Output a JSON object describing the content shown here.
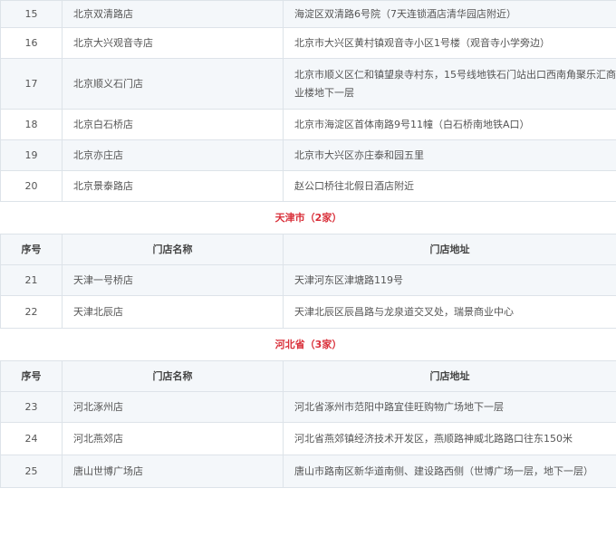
{
  "regions": [
    {
      "title": "",
      "show_header": false,
      "rows": [
        {
          "no": "15",
          "name": "北京双清路店",
          "addr": "海淀区双清路6号院（7天连锁酒店清华园店附近）"
        },
        {
          "no": "16",
          "name": "北京大兴观音寺店",
          "addr": "北京市大兴区黄村镇观音寺小区1号楼（观音寺小学旁边）"
        },
        {
          "no": "17",
          "name": "北京顺义石门店",
          "addr": "北京市顺义区仁和镇望泉寺村东，15号线地铁石门站出口西南角聚乐汇商业楼地下一层"
        },
        {
          "no": "18",
          "name": "北京白石桥店",
          "addr": "北京市海淀区首体南路9号11幢（白石桥南地铁A口）"
        },
        {
          "no": "19",
          "name": "北京亦庄店",
          "addr": "北京市大兴区亦庄泰和园五里"
        },
        {
          "no": "20",
          "name": "北京景泰路店",
          "addr": "赵公口桥往北假日酒店附近"
        }
      ]
    },
    {
      "title": "天津市（2家）",
      "show_header": true,
      "rows": [
        {
          "no": "21",
          "name": "天津一号桥店",
          "addr": "天津河东区津塘路119号"
        },
        {
          "no": "22",
          "name": "天津北辰店",
          "addr": "天津北辰区辰昌路与龙泉道交叉处，瑞景商业中心"
        }
      ]
    },
    {
      "title": "河北省（3家）",
      "show_header": true,
      "rows": [
        {
          "no": "23",
          "name": "河北涿州店",
          "addr": "河北省涿州市范阳中路宜佳旺购物广场地下一层"
        },
        {
          "no": "24",
          "name": "河北燕郊店",
          "addr": "河北省燕郊镇经济技术开发区，燕顺路神威北路路口往东150米"
        },
        {
          "no": "25",
          "name": "唐山世博广场店",
          "addr": "唐山市路南区新华道南侧、建设路西侧（世博广场一层，地下一层）"
        }
      ]
    }
  ],
  "header": {
    "col_no": "序号",
    "col_name": "门店名称",
    "col_addr": "门店地址"
  },
  "colors": {
    "region_title": "#d9303a",
    "border": "#dde3e9",
    "stripe": "#f4f7fa"
  }
}
